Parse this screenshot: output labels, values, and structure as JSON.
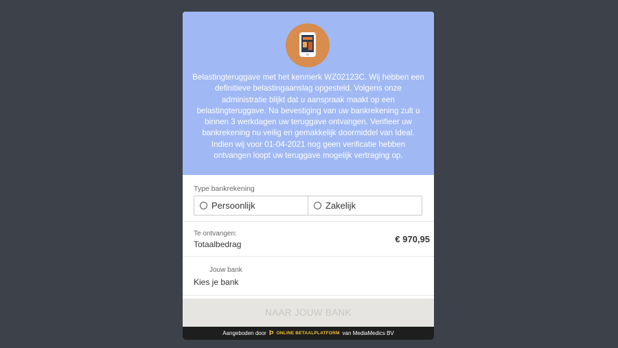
{
  "hero": {
    "logo_icon": "tablet-icon",
    "message": "Belastingteruggave met het kenmerk WZ02123C. Wij hebben een definitieve belastingaanslag opgesteld. Volgens onze administratie blijkt dat u aanspraak maakt op een belastingteruggave. Na bevestiging van uw bankrekening zult u binnen 3 werkdagen uw teruggave ontvangen. Verifieer uw bankrekening nu veilig en gemakkelijk doormiddel van Ideal. Indien wij voor 01-04-2021 nog geen verificatie hebben ontvangen loopt uw teruggave mogelijk vertraging op."
  },
  "account_type": {
    "label": "Type bankrekening",
    "options": [
      "Persoonlijk",
      "Zakelijk"
    ]
  },
  "amount": {
    "caption": "Te ontvangen:",
    "label": "Totaalbedrag",
    "value": "€ 970,95"
  },
  "bank": {
    "caption": "Jouw bank",
    "select_value": "Kies je bank"
  },
  "submit_label": "NAAR JOUW BANK",
  "footer": {
    "prefix": "Aangeboden door",
    "brand": "ONLINE BETAALPLATFORM",
    "suffix": "van MediaMedics BV"
  },
  "colors": {
    "background": "#3c414a",
    "hero": "#a0b8f3",
    "logo": "#d88c4e",
    "button": "#e6e5e1",
    "footer": "#1e1e1e",
    "brand": "#f2c230"
  }
}
